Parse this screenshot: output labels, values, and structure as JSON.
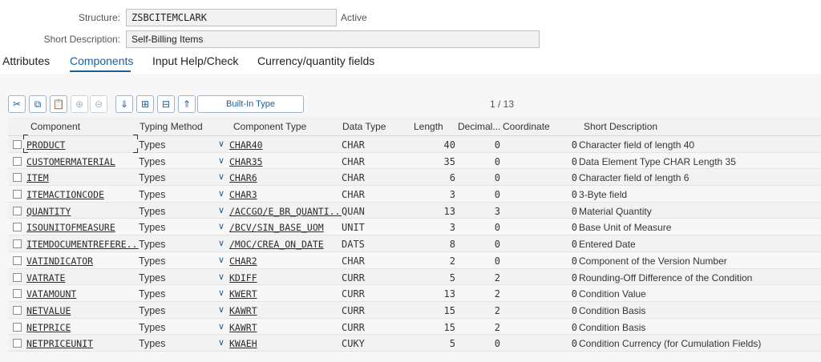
{
  "header": {
    "structure_label": "Structure:",
    "structure_value": "ZSBCITEMCLARK",
    "status": "Active",
    "shortdesc_label": "Short Description:",
    "shortdesc_value": "Self-Billing Items"
  },
  "tabs": [
    {
      "label": "Attributes"
    },
    {
      "label": "Components",
      "active": true
    },
    {
      "label": "Input Help/Check"
    },
    {
      "label": "Currency/quantity fields"
    }
  ],
  "toolbar": {
    "builtin_label": "Built-In Type",
    "pager": "1  /  13",
    "icons": [
      "cut-icon",
      "copy-icon",
      "paste-icon",
      "add-row-icon",
      "delete-row-icon",
      "expand-all-icon",
      "insert-row-icon",
      "delete-field-icon",
      "collapse-all-icon"
    ]
  },
  "table": {
    "headers": [
      "Component",
      "Typing Method",
      "Component Type",
      "Data Type",
      "Length",
      "Decimal...",
      "Coordinate",
      "Short Description"
    ],
    "rows": [
      {
        "component": "PRODUCT",
        "typing": "Types",
        "ctype": "CHAR40",
        "dtype": "CHAR",
        "length": "40",
        "decimal": "0",
        "coord": "0",
        "desc": "Character field of length 40"
      },
      {
        "component": "CUSTOMERMATERIAL",
        "typing": "Types",
        "ctype": "CHAR35",
        "dtype": "CHAR",
        "length": "35",
        "decimal": "0",
        "coord": "0",
        "desc": "Data Element Type CHAR Length 35"
      },
      {
        "component": "ITEM",
        "typing": "Types",
        "ctype": "CHAR6",
        "dtype": "CHAR",
        "length": "6",
        "decimal": "0",
        "coord": "0",
        "desc": "Character field of length 6"
      },
      {
        "component": "ITEMACTIONCODE",
        "typing": "Types",
        "ctype": "CHAR3",
        "dtype": "CHAR",
        "length": "3",
        "decimal": "0",
        "coord": "0",
        "desc": "3-Byte field"
      },
      {
        "component": "QUANTITY",
        "typing": "Types",
        "ctype": "/ACCGO/E_BR_QUANTI...",
        "dtype": "QUAN",
        "length": "13",
        "decimal": "3",
        "coord": "0",
        "desc": "Material Quantity"
      },
      {
        "component": "ISOUNITOFMEASURE",
        "typing": "Types",
        "ctype": "/BCV/SIN_BASE_UOM",
        "dtype": "UNIT",
        "length": "3",
        "decimal": "0",
        "coord": "0",
        "desc": "Base Unit of Measure"
      },
      {
        "component": "ITEMDOCUMENTREFERE...",
        "typing": "Types",
        "ctype": "/MOC/CREA_ON_DATE",
        "dtype": "DATS",
        "length": "8",
        "decimal": "0",
        "coord": "0",
        "desc": "Entered Date"
      },
      {
        "component": "VATINDICATOR",
        "typing": "Types",
        "ctype": "CHAR2",
        "dtype": "CHAR",
        "length": "2",
        "decimal": "0",
        "coord": "0",
        "desc": "Component of the Version Number"
      },
      {
        "component": "VATRATE",
        "typing": "Types",
        "ctype": "KDIFF",
        "dtype": "CURR",
        "length": "5",
        "decimal": "2",
        "coord": "0",
        "desc": "Rounding-Off Difference of the Condition"
      },
      {
        "component": "VATAMOUNT",
        "typing": "Types",
        "ctype": "KWERT",
        "dtype": "CURR",
        "length": "13",
        "decimal": "2",
        "coord": "0",
        "desc": "Condition Value"
      },
      {
        "component": "NETVALUE",
        "typing": "Types",
        "ctype": "KAWRT",
        "dtype": "CURR",
        "length": "15",
        "decimal": "2",
        "coord": "0",
        "desc": "Condition Basis"
      },
      {
        "component": "NETPRICE",
        "typing": "Types",
        "ctype": "KAWRT",
        "dtype": "CURR",
        "length": "15",
        "decimal": "2",
        "coord": "0",
        "desc": "Condition Basis"
      },
      {
        "component": "NETPRICEUNIT",
        "typing": "Types",
        "ctype": "KWAEH",
        "dtype": "CUKY",
        "length": "5",
        "decimal": "0",
        "coord": "0",
        "desc": "Condition Currency (for Cumulation Fields)"
      }
    ]
  },
  "colors": {
    "accent": "#1a5e9a"
  }
}
